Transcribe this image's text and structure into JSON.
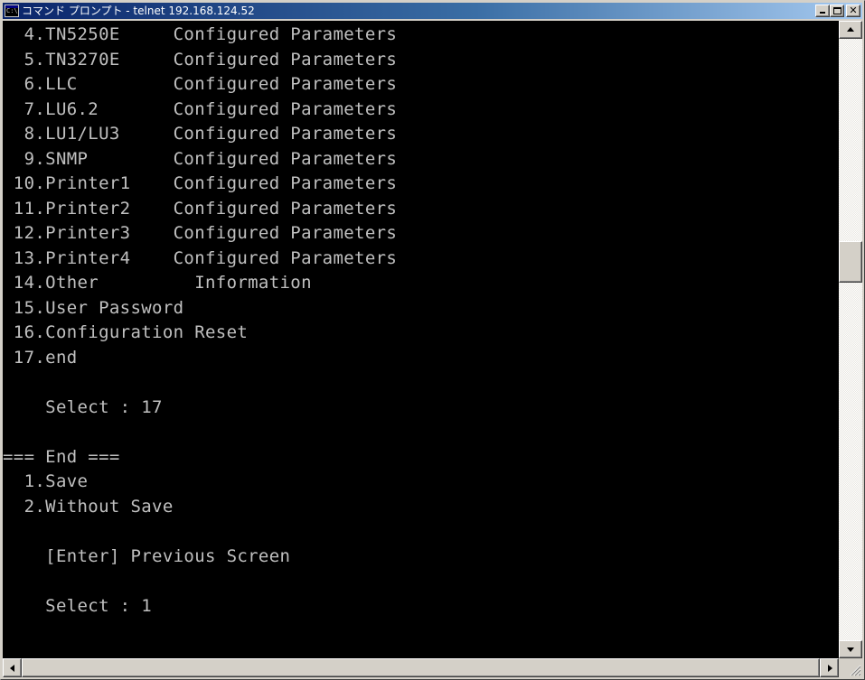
{
  "window": {
    "title": "コマンド プロンプト - telnet 192.168.124.52",
    "icon": "console-icon",
    "icon_glyph": "C:\\"
  },
  "title_buttons": {
    "minimize_icon": "minimize-icon",
    "maximize_icon": "maximize-icon",
    "close_icon": "close-icon",
    "close_glyph": "✕"
  },
  "console": {
    "colors": {
      "background": "#000000",
      "foreground": "#c0c0c0"
    },
    "lines": [
      "  4.TN5250E     Configured Parameters",
      "  5.TN3270E     Configured Parameters",
      "  6.LLC         Configured Parameters",
      "  7.LU6.2       Configured Parameters",
      "  8.LU1/LU3     Configured Parameters",
      "  9.SNMP        Configured Parameters",
      " 10.Printer1    Configured Parameters",
      " 11.Printer2    Configured Parameters",
      " 12.Printer3    Configured Parameters",
      " 13.Printer4    Configured Parameters",
      " 14.Other         Information",
      " 15.User Password",
      " 16.Configuration Reset",
      " 17.end",
      "",
      "    Select : 17",
      "",
      "=== End ===",
      "  1.Save",
      "  2.Without Save",
      "",
      "    [Enter] Previous Screen",
      "",
      "    Select : 1"
    ]
  },
  "scrollbars": {
    "vertical": {
      "up_icon": "scroll-up-arrow-icon",
      "down_icon": "scroll-down-arrow-icon"
    },
    "horizontal": {
      "left_icon": "scroll-left-arrow-icon",
      "right_icon": "scroll-right-arrow-icon"
    }
  }
}
